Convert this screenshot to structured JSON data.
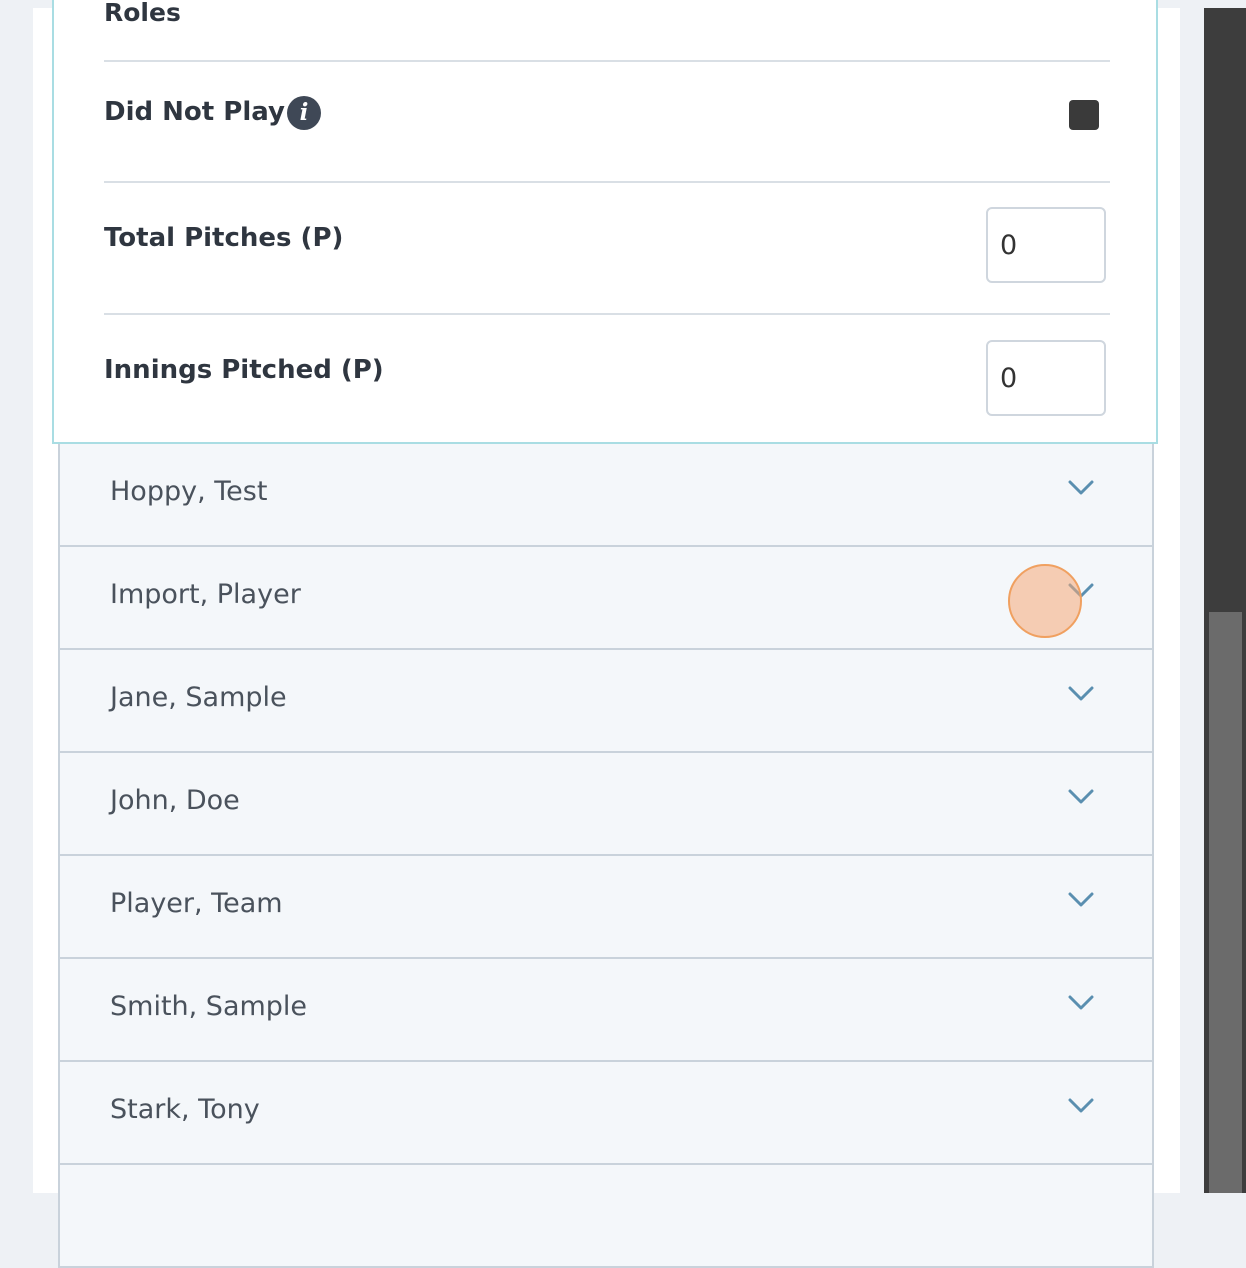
{
  "player_card": {
    "roles_label": "Roles",
    "did_not_play_label": "Did Not Play",
    "total_pitches_label": "Total Pitches (P)",
    "total_pitches_value": "0",
    "innings_pitched_label": "Innings Pitched (P)",
    "innings_pitched_value": "0",
    "did_not_play_checked": true
  },
  "players": [
    {
      "name": "Hoppy, Test"
    },
    {
      "name": "Import, Player"
    },
    {
      "name": "Jane, Sample"
    },
    {
      "name": "John, Doe"
    },
    {
      "name": "Player, Team"
    },
    {
      "name": "Smith, Sample"
    },
    {
      "name": "Stark, Tony"
    },
    {
      "name": ""
    }
  ],
  "icons": {
    "info": "info-icon",
    "expand": "chevron-down-icon"
  },
  "colors": {
    "card_border": "#a9dde3",
    "row_background": "#f4f7fa",
    "click_indicator": "#f5aa78"
  }
}
